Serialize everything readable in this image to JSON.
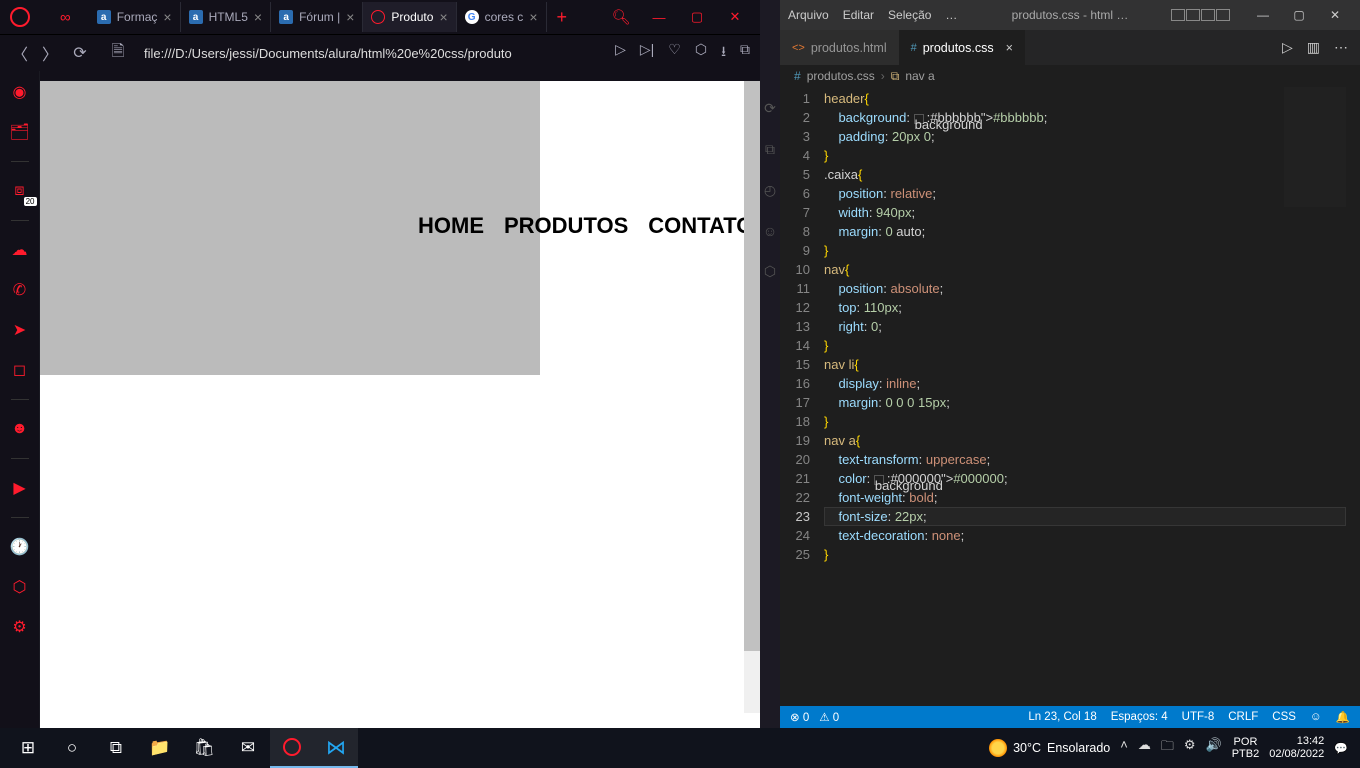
{
  "opera": {
    "tabs": [
      {
        "label": "Formaç",
        "favicon": "a"
      },
      {
        "label": "HTML5",
        "favicon": "a"
      },
      {
        "label": "Fórum |",
        "favicon": "a"
      },
      {
        "label": "Produto",
        "favicon": "opera",
        "active": true
      },
      {
        "label": "cores c",
        "favicon": "google"
      }
    ],
    "url": "file:///D:/Users/jessi/Documents/alura/html%20e%20css/produto",
    "sidebar_badge": "20",
    "page": {
      "nav": [
        "HOME",
        "PRODUTOS",
        "CONTATO"
      ]
    }
  },
  "vscode": {
    "menu": [
      "Arquivo",
      "Editar",
      "Seleção",
      "…"
    ],
    "title": "produtos.css - html …",
    "tabs": [
      {
        "label": "produtos.html",
        "icon": "ext",
        "active": false
      },
      {
        "label": "produtos.css",
        "icon": "css",
        "active": true
      }
    ],
    "breadcrumb": {
      "file": "produtos.css",
      "symbol": "nav a"
    },
    "code": {
      "lines": [
        {
          "n": 1,
          "t": "header{"
        },
        {
          "n": 2,
          "t": "    background: ▢#bbbbbb;"
        },
        {
          "n": 3,
          "t": "    padding: 20px 0;"
        },
        {
          "n": 4,
          "t": "}"
        },
        {
          "n": 5,
          "t": ".caixa{"
        },
        {
          "n": 6,
          "t": "    position: relative;"
        },
        {
          "n": 7,
          "t": "    width: 940px;"
        },
        {
          "n": 8,
          "t": "    margin: 0 auto;"
        },
        {
          "n": 9,
          "t": "}"
        },
        {
          "n": 10,
          "t": "nav{"
        },
        {
          "n": 11,
          "t": "    position: absolute;"
        },
        {
          "n": 12,
          "t": "    top: 110px;"
        },
        {
          "n": 13,
          "t": "    right: 0;"
        },
        {
          "n": 14,
          "t": "}"
        },
        {
          "n": 15,
          "t": "nav li{"
        },
        {
          "n": 16,
          "t": "    display: inline;"
        },
        {
          "n": 17,
          "t": "    margin: 0 0 0 15px;"
        },
        {
          "n": 18,
          "t": "}"
        },
        {
          "n": 19,
          "t": "nav a{"
        },
        {
          "n": 20,
          "t": "    text-transform: uppercase;"
        },
        {
          "n": 21,
          "t": "    color: ▢#000000;"
        },
        {
          "n": 22,
          "t": "    font-weight: bold;"
        },
        {
          "n": 23,
          "t": "    font-size: 22px;",
          "cur": true
        },
        {
          "n": 24,
          "t": "    text-decoration: none;"
        },
        {
          "n": 25,
          "t": "}"
        }
      ]
    },
    "status": {
      "errors": "⊗ 0",
      "warnings": "⚠ 0",
      "position": "Ln 23, Col 18",
      "spaces": "Espaços: 4",
      "encoding": "UTF-8",
      "eol": "CRLF",
      "lang": "CSS"
    }
  },
  "taskbar": {
    "weather": {
      "temp": "30°C",
      "desc": "Ensolarado"
    },
    "lang": {
      "l1": "POR",
      "l2": "PTB2"
    },
    "clock": {
      "time": "13:42",
      "date": "02/08/2022"
    }
  }
}
